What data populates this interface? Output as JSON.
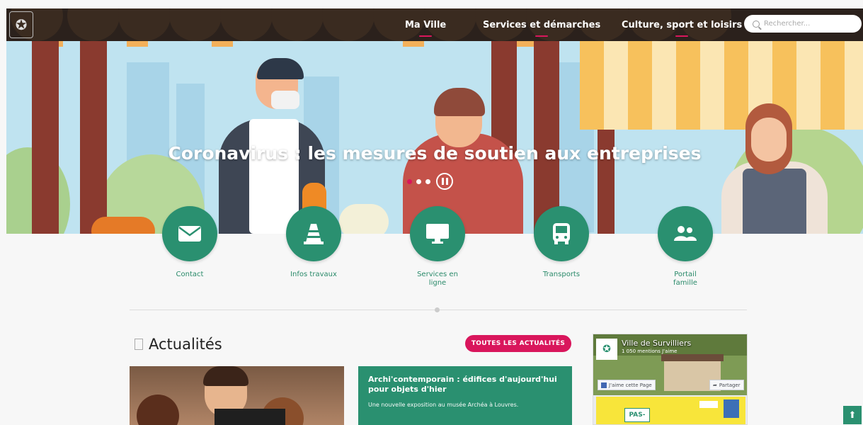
{
  "header": {
    "logo_icon": "city-crest-icon",
    "nav": [
      {
        "label": "Ma Ville"
      },
      {
        "label": "Services et démarches"
      },
      {
        "label": "Culture, sport et loisirs"
      }
    ],
    "search_placeholder": "Rechercher..."
  },
  "hero": {
    "title": "Coronavirus : les mesures de soutien aux entreprises",
    "slides_count": 3,
    "active_slide": 1
  },
  "quick_links": [
    {
      "label": "Contact",
      "icon": "envelope-icon"
    },
    {
      "label": "Infos travaux",
      "icon": "traffic-cone-icon"
    },
    {
      "label": "Services en ligne",
      "icon": "monitor-icon"
    },
    {
      "label": "Transports",
      "icon": "bus-icon"
    },
    {
      "label": "Portail famille",
      "icon": "family-icon"
    }
  ],
  "news": {
    "section_title": "Actualités",
    "all_button": "TOUTES LES ACTUALITÉS",
    "featured": {
      "title": "Archi'contemporain : édifices d'aujourd'hui pour objets d'hier",
      "description": "Une nouvelle exposition au musée Archéa à Louvres."
    }
  },
  "facebook": {
    "page_name": "Ville de Survilliers",
    "likes": "1 050 mentions J'aime",
    "like_button": "J'aime cette Page",
    "share_button": "Partager",
    "post_text": "PAS-"
  },
  "colors": {
    "accent": "#d9165c",
    "green": "#2a9070",
    "header_bg": "#2b211c"
  }
}
